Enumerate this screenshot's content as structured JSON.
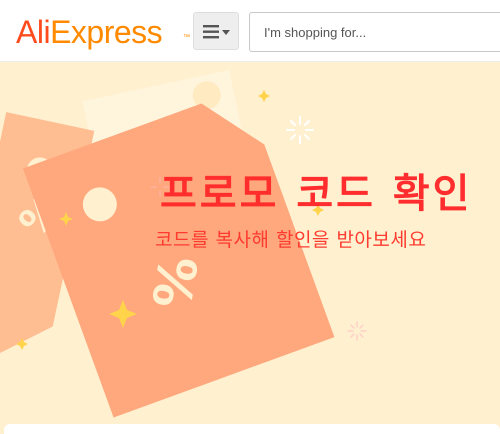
{
  "header": {
    "logo": {
      "ali": "Ali",
      "express": "Express",
      "tm": "™"
    },
    "menu_icon": "hamburger-menu-icon",
    "search": {
      "placeholder": "I'm shopping for...",
      "value": ""
    }
  },
  "banner": {
    "title": "프로모 코드 확인",
    "subtitle": "코드를 복사해 할인을 받아보세요"
  },
  "colors": {
    "logo_red": "#ff4c1f",
    "logo_orange": "#ff8a00",
    "banner_bg": "#fff0cf",
    "tag_salmon": "#ffa77d",
    "title_red": "#ff2d2d"
  }
}
